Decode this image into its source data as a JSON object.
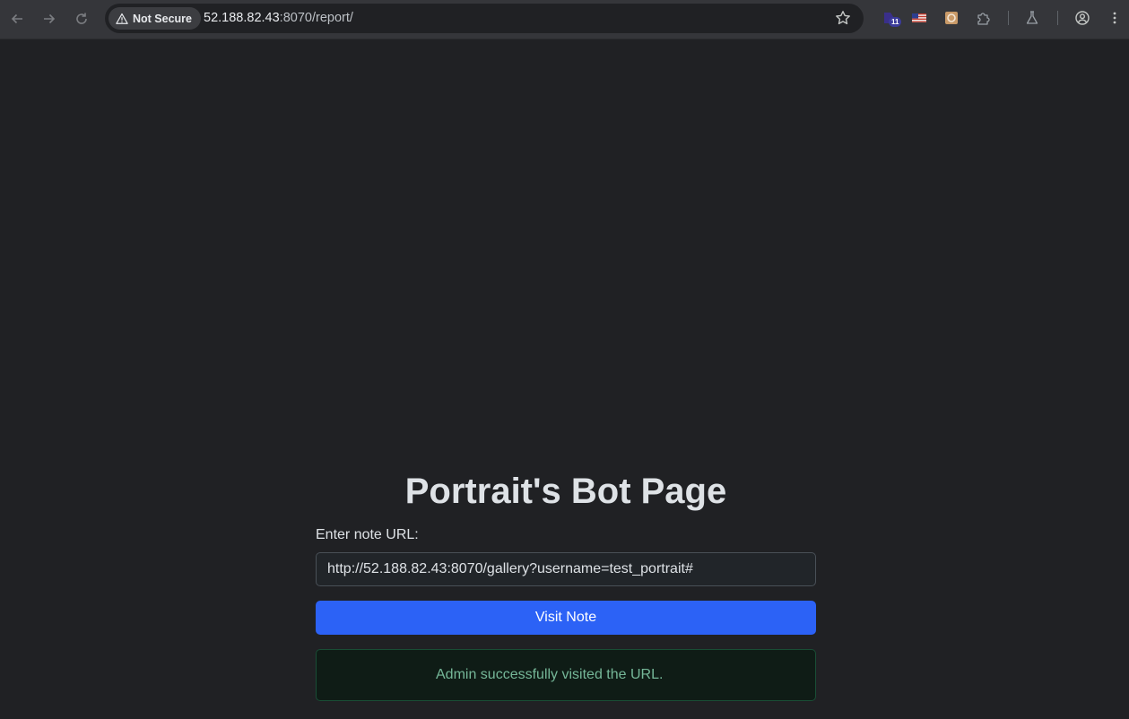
{
  "browser": {
    "security_label": "Not Secure",
    "url_host": "52.188.82.43",
    "url_rest": ":8070/report/",
    "extension_badge": "11"
  },
  "page": {
    "title": "Portrait's Bot Page",
    "input_label": "Enter note URL:",
    "input_value": "http://52.188.82.43:8070/gallery?username=test_portrait#",
    "button_label": "Visit Note",
    "alert_message": "Admin successfully visited the URL."
  },
  "colors": {
    "page_background": "#202124",
    "primary_button": "#2c62f6",
    "success_text": "#75b798",
    "success_background": "#0f1c16"
  }
}
